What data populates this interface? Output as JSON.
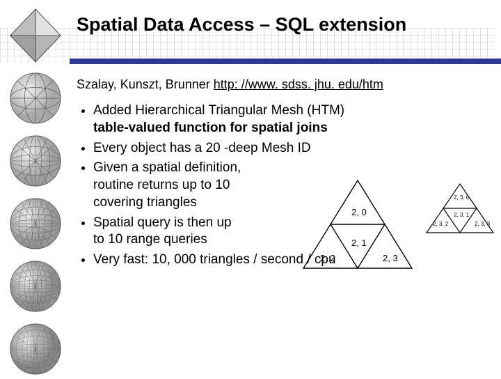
{
  "title": "Spatial Data Access – SQL extension",
  "authors": {
    "names": "Szalay, Kunszt, Brunner",
    "link": "http: //www. sdss. jhu. edu/htm"
  },
  "bullets": {
    "b1a": "Added Hierarchical Triangular Mesh (HTM)",
    "b1b": "table-valued function for spatial joins",
    "b2": "Every object has a 20 -deep Mesh ID",
    "b3a": "Given a spatial definition,",
    "b3b": "routine returns up to 10",
    "b3c": "covering triangles",
    "b4a": "Spatial query is then up",
    "b4b": "to 10 range queries",
    "b5": "Very fast:  10, 000 triangles / second / cpu"
  },
  "tri": {
    "big": {
      "l20": "2, 0",
      "l21": "2, 1",
      "l22": "2, 2",
      "l23": "2, 3"
    },
    "small": {
      "l230": "2, 3, 0",
      "l231": "2, 3, 1",
      "l232": "2, 3, 2",
      "l233": "2, 3, 3"
    }
  }
}
